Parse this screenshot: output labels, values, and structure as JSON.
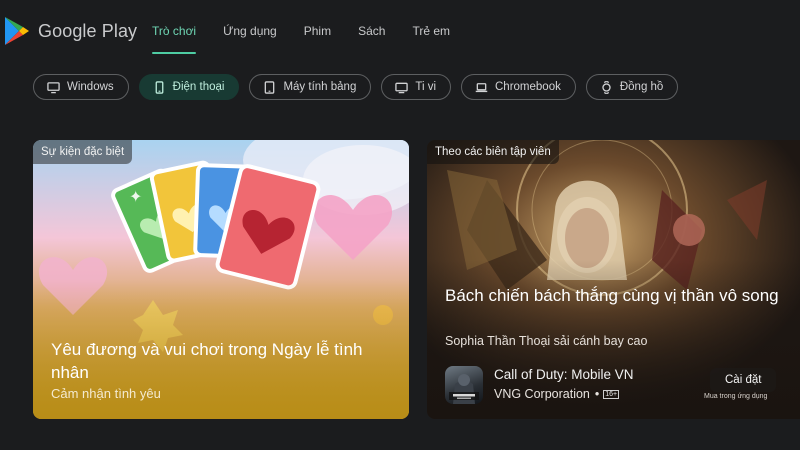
{
  "header": {
    "logo_text": "Google Play",
    "nav": [
      {
        "label": "Trò chơi",
        "active": true
      },
      {
        "label": "Ứng dụng",
        "active": false
      },
      {
        "label": "Phim",
        "active": false
      },
      {
        "label": "Sách",
        "active": false
      },
      {
        "label": "Trẻ em",
        "active": false
      }
    ]
  },
  "chips": [
    {
      "label": "Windows",
      "icon": "monitor-icon",
      "active": false
    },
    {
      "label": "Điện thoại",
      "icon": "phone-icon",
      "active": true
    },
    {
      "label": "Máy tính bảng",
      "icon": "tablet-icon",
      "active": false
    },
    {
      "label": "Ti vi",
      "icon": "tv-icon",
      "active": false
    },
    {
      "label": "Chromebook",
      "icon": "laptop-icon",
      "active": false
    },
    {
      "label": "Đồng hồ",
      "icon": "watch-icon",
      "active": false
    }
  ],
  "cards": {
    "left": {
      "badge": "Sự kiện đặc biệt",
      "title": "Yêu đương và vui chơi trong Ngày lễ tình nhân",
      "subtitle": "Cảm nhận tình yêu"
    },
    "right": {
      "badge": "Theo các biên tập viên",
      "title": "Bách chiến bách thắng cùng vị thần vô song",
      "subtitle": "Sophia Thần Thoại sải cánh bay cao",
      "app": {
        "name": "Call of Duty: Mobile VN",
        "developer": "VNG Corporation",
        "dot": "•",
        "rating": "16+",
        "install_label": "Cài đặt",
        "iap_note": "Mua trong ứng dụng"
      }
    }
  },
  "colors": {
    "background": "#1b1c1e",
    "accent": "#4ecca3",
    "active_chip": "#183a33"
  }
}
